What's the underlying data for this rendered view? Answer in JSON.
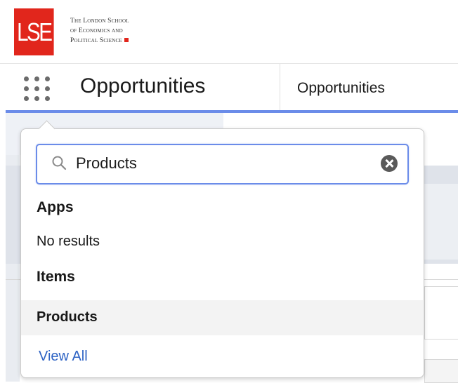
{
  "logo": {
    "mark": "LSE",
    "line1": "The London School",
    "line2": "of Economics and",
    "line3": "Political Science",
    "brand_color": "#e1261c"
  },
  "navbar": {
    "app_launcher_icon": "app-launcher-grid-icon",
    "app_name": "Opportunities",
    "tabs": [
      {
        "label": "Opportunities"
      }
    ],
    "accent_color": "#6b8ce9"
  },
  "launcher_dropdown": {
    "search": {
      "icon": "search-icon",
      "value": "Products",
      "clear_icon": "clear-icon"
    },
    "apps_heading": "Apps",
    "apps_empty_text": "No results",
    "items_heading": "Items",
    "items": [
      {
        "label": "Products"
      }
    ],
    "view_all_label": "View All",
    "link_color": "#2e63c4"
  }
}
